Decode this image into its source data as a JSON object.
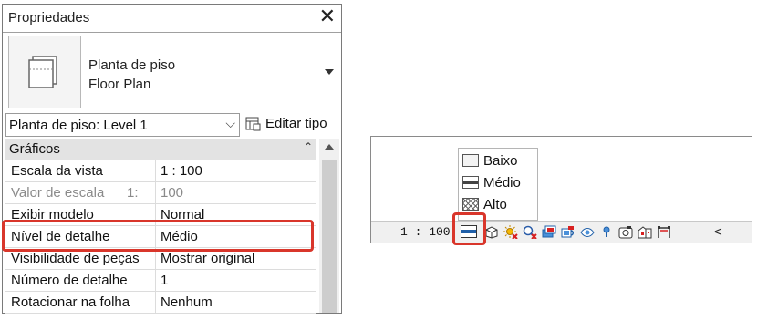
{
  "properties": {
    "title": "Propriedades",
    "type_name_line1": "Planta de piso",
    "type_name_line2": "Floor Plan",
    "instance_selector": "Planta de piso: Level 1",
    "edit_type_label": "Editar tipo",
    "group": "Gráficos",
    "rows": [
      {
        "label": "Escala da vista",
        "value": "1 : 100"
      },
      {
        "label": "Valor de escala",
        "label_suffix": "1:",
        "value": "100",
        "disabled": true
      },
      {
        "label": "Exibir modelo",
        "value": "Normal"
      },
      {
        "label": "Nível de detalhe",
        "value": "Médio"
      },
      {
        "label": "Visibilidade de peças",
        "value": "Mostrar original"
      },
      {
        "label": "Número de detalhe",
        "value": "1"
      },
      {
        "label": "Rotacionar na folha",
        "value": "Nenhum"
      }
    ],
    "highlighted_row": "Nível de detalhe",
    "highlight_color": "#d9362b"
  },
  "status_bar": {
    "scale": "1 : 100",
    "detail_level_menu": [
      {
        "label": "Baixo",
        "icon": "detail-low-icon"
      },
      {
        "label": "Médio",
        "icon": "detail-medium-icon"
      },
      {
        "label": "Alto",
        "icon": "detail-high-icon"
      }
    ],
    "icons": [
      "detail-level-icon",
      "visual-style-icon",
      "sun-path-icon",
      "shadows-icon",
      "crop-view-icon",
      "show-crop-region-icon",
      "unlock-3d-view-icon",
      "temporary-hide-icon",
      "reveal-hidden-icon",
      "temporary-view-properties-icon",
      "analytical-model-icon",
      "highlight-displacement-icon",
      "collapse-icon"
    ],
    "collapse_glyph": "<"
  }
}
